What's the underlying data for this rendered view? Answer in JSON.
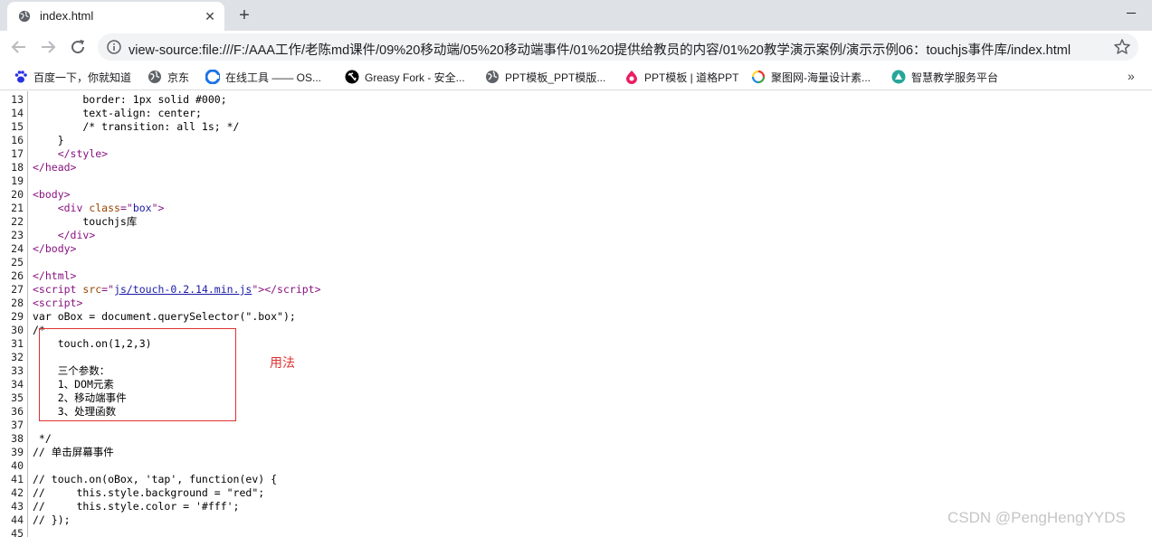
{
  "tab": {
    "title": "index.html",
    "favicon": "globe-icon"
  },
  "toolbar": {
    "url": "view-source:file:///F:/AAA工作/老陈md课件/09%20移动端/05%20移动端事件/01%20提供给教员的内容/01%20教学演示案例/演示示例06：touchjs事件库/index.html"
  },
  "bookmarks": [
    {
      "label": "百度一下，你就知道",
      "icon": "baidu-paw-icon",
      "color": "#2932e1"
    },
    {
      "label": "京东",
      "icon": "globe-icon",
      "color": "#5f6368"
    },
    {
      "label": "在线工具 —— OS...",
      "icon": "osc-tool-icon",
      "color": "#1a73e8"
    },
    {
      "label": "Greasy Fork - 安全...",
      "icon": "greasy-fork-icon",
      "color": "#000000"
    },
    {
      "label": "PPT模板_PPT模版...",
      "icon": "globe-icon",
      "color": "#5f6368"
    },
    {
      "label": "PPT模板 | 道格PPT",
      "icon": "doug-ppt-icon",
      "color": "#e91e63"
    },
    {
      "label": "聚图网-海量设计素...",
      "icon": "jutu-icon",
      "color": "#ff9800"
    },
    {
      "label": "智慧教学服务平台",
      "icon": "edu-platform-icon",
      "color": "#26a69a"
    }
  ],
  "source_lines": [
    {
      "n": "13",
      "html": "        border: 1px solid #000;"
    },
    {
      "n": "14",
      "html": "        text-align: center;"
    },
    {
      "n": "15",
      "html": "        /* transition: all 1s; */"
    },
    {
      "n": "16",
      "html": "    }"
    },
    {
      "n": "17",
      "html": "    <span class=\"t\">&lt;/style&gt;</span>"
    },
    {
      "n": "18",
      "html": "<span class=\"t\">&lt;/head&gt;</span>"
    },
    {
      "n": "19",
      "html": ""
    },
    {
      "n": "20",
      "html": "<span class=\"t\">&lt;body&gt;</span>"
    },
    {
      "n": "21",
      "html": "    <span class=\"t\">&lt;div <span class=\"a\">class</span>=\"<span class=\"v\">box</span>\"&gt;</span>"
    },
    {
      "n": "22",
      "html": "        touchjs库"
    },
    {
      "n": "23",
      "html": "    <span class=\"t\">&lt;/div&gt;</span>"
    },
    {
      "n": "24",
      "html": "<span class=\"t\">&lt;/body&gt;</span>"
    },
    {
      "n": "25",
      "html": ""
    },
    {
      "n": "26",
      "html": "<span class=\"t\">&lt;/html&gt;</span>"
    },
    {
      "n": "27",
      "html": "<span class=\"t\">&lt;script <span class=\"a\">src</span>=\"<span class=\"lnk\">js/touch-0.2.14.min.js</span>\"&gt;&lt;/script&gt;</span>"
    },
    {
      "n": "28",
      "html": "<span class=\"t\">&lt;script&gt;</span>"
    },
    {
      "n": "29",
      "html": "var oBox = document.querySelector(\".box\");"
    },
    {
      "n": "30",
      "html": "/*"
    },
    {
      "n": "31",
      "html": "    touch.on(1,2,3)"
    },
    {
      "n": "32",
      "html": ""
    },
    {
      "n": "33",
      "html": "    三个参数："
    },
    {
      "n": "34",
      "html": "    1、DOM元素"
    },
    {
      "n": "35",
      "html": "    2、移动端事件"
    },
    {
      "n": "36",
      "html": "    3、处理函数"
    },
    {
      "n": "37",
      "html": ""
    },
    {
      "n": "38",
      "html": " */"
    },
    {
      "n": "39",
      "html": "// 单击屏幕事件"
    },
    {
      "n": "40",
      "html": ""
    },
    {
      "n": "41",
      "html": "// touch.on(oBox, 'tap', function(ev) {"
    },
    {
      "n": "42",
      "html": "//     this.style.background = \"red\";"
    },
    {
      "n": "43",
      "html": "//     this.style.color = '#fff';"
    },
    {
      "n": "44",
      "html": "// });"
    },
    {
      "n": "45",
      "html": ""
    }
  ],
  "annotation": {
    "note": "用法",
    "color": "#e03131"
  },
  "watermark": "CSDN @PengHengYYDS"
}
